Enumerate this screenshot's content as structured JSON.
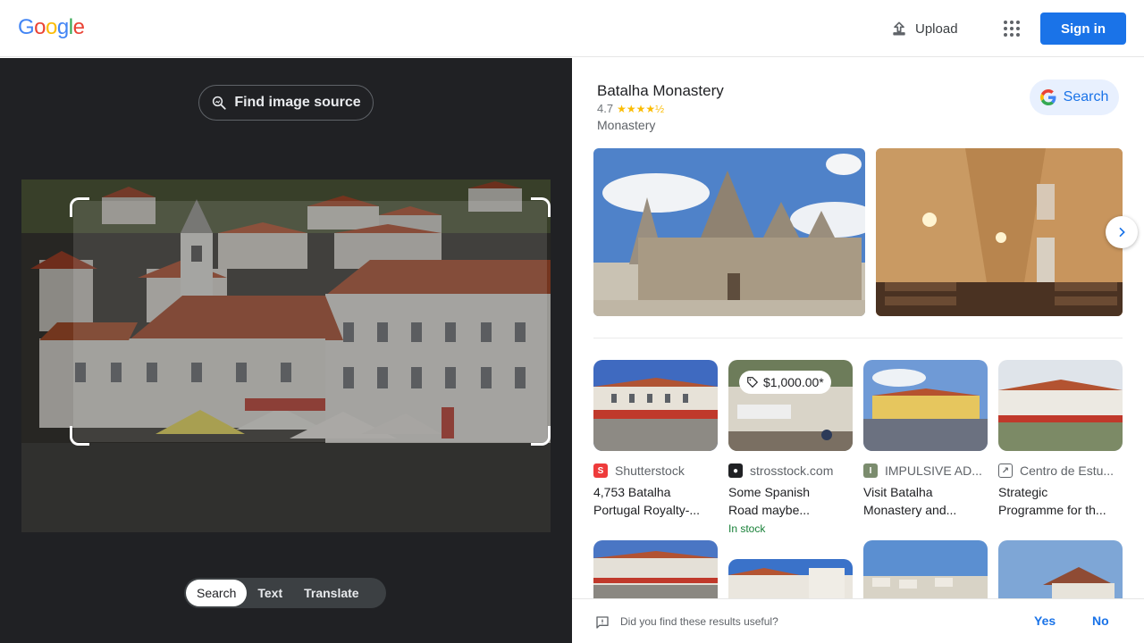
{
  "header": {
    "logo": [
      "G",
      "o",
      "o",
      "g",
      "l",
      "e"
    ],
    "logo_colors": [
      "#4285f4",
      "#ea4335",
      "#fbbc05",
      "#4285f4",
      "#34a853",
      "#ea4335"
    ],
    "upload_label": "Upload",
    "signin_label": "Sign in"
  },
  "left": {
    "find_source_label": "Find image source",
    "tabs": [
      {
        "label": "Search",
        "active": true
      },
      {
        "label": "Text",
        "active": false
      },
      {
        "label": "Translate",
        "active": false
      }
    ]
  },
  "knowledge_panel": {
    "title": "Batalha Monastery",
    "rating": "4.7",
    "stars": "★★★★½",
    "subtitle": "Monastery",
    "search_label": "Search"
  },
  "results": [
    {
      "source": "Shutterstock",
      "favicon_color": "#ee3b3b",
      "title_lines": [
        "4,753 Batalha",
        "Portugal Royalty-..."
      ],
      "price": null,
      "stock": null
    },
    {
      "source": "strosstock.com",
      "favicon_color": "#202124",
      "title_lines": [
        "Some Spanish",
        "Road maybe..."
      ],
      "price": "$1,000.00*",
      "stock": "In stock"
    },
    {
      "source": "IMPULSIVE AD...",
      "favicon_color": "#7b8c6e",
      "title_lines": [
        "Visit Batalha",
        "Monastery and..."
      ],
      "price": null,
      "stock": null
    },
    {
      "source": "Centro de Estu...",
      "favicon_color": "#ffffff",
      "title_lines": [
        "Strategic",
        "Programme for th..."
      ],
      "price": null,
      "stock": null
    }
  ],
  "feedback": {
    "question": "Did you find these results useful?",
    "yes": "Yes",
    "no": "No"
  },
  "colors": {
    "accent": "#1a73e8",
    "dark_panel": "#202124",
    "in_stock": "#188038"
  }
}
